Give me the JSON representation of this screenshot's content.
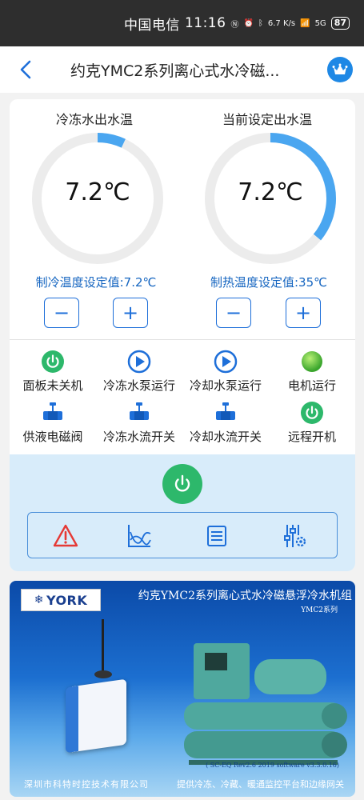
{
  "statusbar": {
    "carrier": "中国电信",
    "time": "11:16",
    "net_speed": "6.7 K/s",
    "signal": "5G",
    "battery": "87"
  },
  "navbar": {
    "title": "约克YMC2系列离心式水冷磁..."
  },
  "gauges": [
    {
      "label": "冷冻水出水温",
      "value": "7.2℃",
      "level": 0.07,
      "color": "#4aa6f0"
    },
    {
      "label": "当前设定出水温",
      "value": "7.2℃",
      "level": 0.36,
      "color": "#4aa6f0"
    }
  ],
  "setpoints": {
    "cooling": "制冷温度设定值:7.2℃",
    "heating": "制热温度设定值:35℃",
    "minus": "−",
    "plus": "+"
  },
  "status_items": [
    {
      "label": "面板未关机",
      "icon": "power-green-icon"
    },
    {
      "label": "冷冻水泵运行",
      "icon": "pump-play-icon"
    },
    {
      "label": "冷却水泵运行",
      "icon": "pump-play-icon"
    },
    {
      "label": "电机运行",
      "icon": "motor-green-icon"
    },
    {
      "label": "供液电磁阀",
      "icon": "valve-icon"
    },
    {
      "label": "冷冻水流开关",
      "icon": "valve-icon"
    },
    {
      "label": "冷却水流开关",
      "icon": "valve-icon"
    },
    {
      "label": "远程开机",
      "icon": "power-green-icon"
    }
  ],
  "toolbar_icons": [
    "alarm-icon",
    "trend-chart-icon",
    "list-icon",
    "settings-sliders-icon"
  ],
  "colors": {
    "accent": "#1e6fd9",
    "setpoint_text": "#1565c0",
    "status_green": "#2db86b",
    "control_bg": "#d8ecfa",
    "alarm_red": "#e53935"
  },
  "banner": {
    "logo": "YORK",
    "title": "约克YMC2系列离心式水冷磁悬浮冷水机组",
    "subtitle": "YMC2系列",
    "version": "( SC-EQ Rev2.6 2019 software v3.3.0.16)",
    "footer_left": "深圳市科特时控技术有限公司",
    "footer_right": "提供冷冻、冷藏、暖通监控平台和边缘网关"
  }
}
